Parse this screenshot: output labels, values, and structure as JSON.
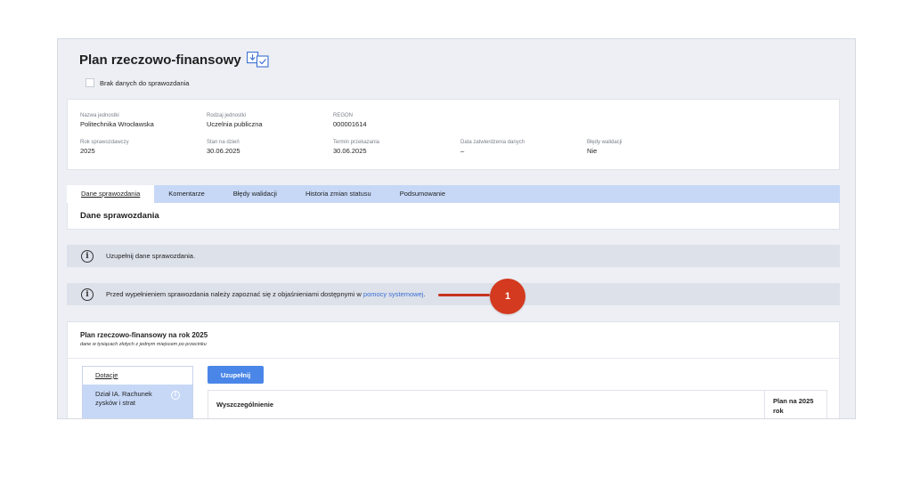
{
  "header": {
    "title": "Plan rzeczowo-finansowy",
    "title_icon": "download-check-icon",
    "no_data_label": "Brak danych do sprawozdania"
  },
  "info": {
    "unit_name_label": "Nazwa jednostki",
    "unit_name_value": "Politechnika Wrocławska",
    "unit_type_label": "Rodzaj jednostki",
    "unit_type_value": "Uczelnia publiczna",
    "regon_label": "REGON",
    "regon_value": "000001614",
    "year_label": "Rok sprawozdawczy",
    "year_value": "2025",
    "state_label": "Stan na dzień",
    "state_value": "30.06.2025",
    "deadline_label": "Termin przekazania",
    "deadline_value": "30.06.2025",
    "approval_label": "Data zatwierdzenia danych",
    "approval_value": "–",
    "errors_label": "Błędy walidacji",
    "errors_value": "Nie"
  },
  "tabs": [
    {
      "label": "Dane sprawozdania"
    },
    {
      "label": "Komentarze"
    },
    {
      "label": "Błędy walidacji"
    },
    {
      "label": "Historia zmian statusu"
    },
    {
      "label": "Podsumowanie"
    }
  ],
  "section_title": "Dane sprawozdania",
  "alerts": {
    "fill_text": "Uzupełnij dane sprawozdania.",
    "help_text_before": "Przed wypełnieniem sprawozdania należy zapoznać się z objaśnieniami dostępnymi w ",
    "help_link": "pomocy systemowej",
    "help_text_after": "."
  },
  "marker": {
    "number": "1",
    "color": "#d33a1f"
  },
  "plan": {
    "title": "Plan rzeczowo-finansowy na rok 2025",
    "subtitle": "dane w tysiącach złotych z jednym miejscem po przecinku",
    "nav_head": "Dotacje",
    "nav_item": "Dział IA. Rachunek zysków i strat",
    "fill_button": "Uzupełnij",
    "col_main": "Wyszczególnienie",
    "col_plan": "Plan na 2025 rok"
  },
  "colors": {
    "accent": "#4a86e8",
    "tab_bar": "#c7d8f7",
    "link": "#3b6fd1"
  }
}
